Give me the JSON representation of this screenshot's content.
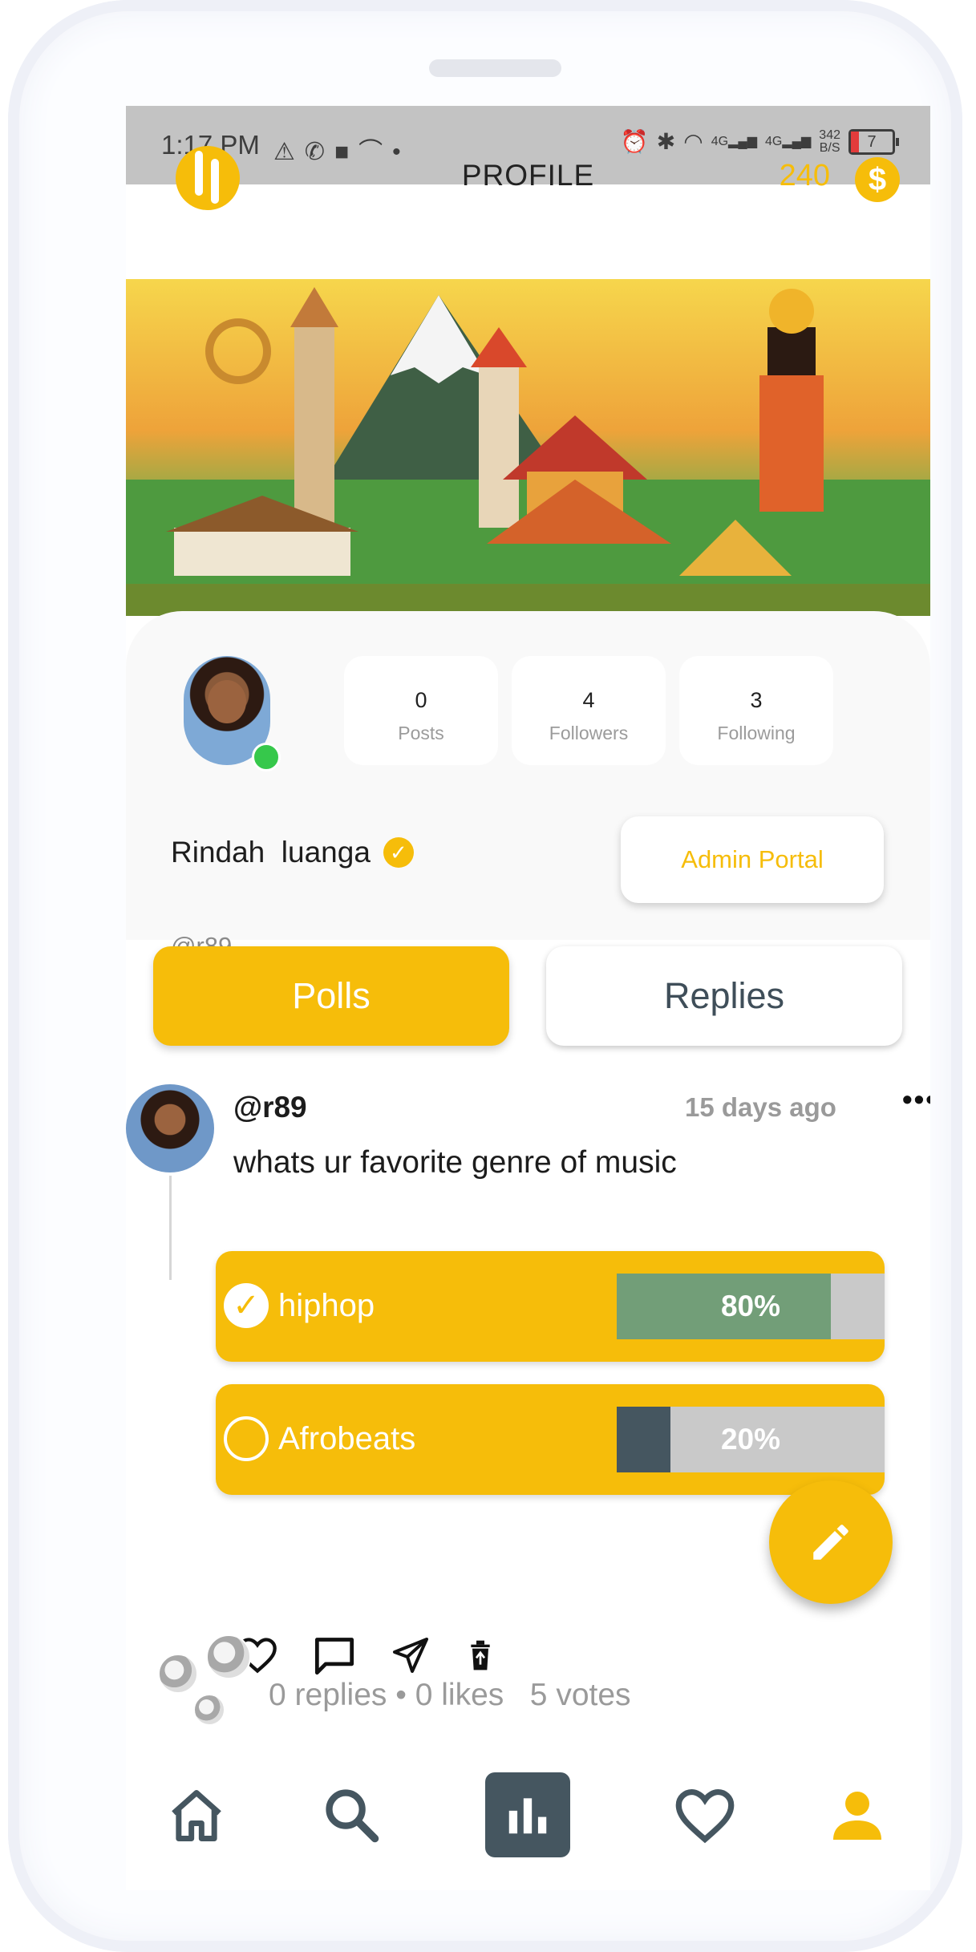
{
  "status_bar": {
    "time": "1:17 PM",
    "net_speed_value": "342",
    "net_speed_unit": "B/S",
    "signal_1": "4G",
    "signal_2": "4G",
    "battery": "7"
  },
  "header": {
    "title": "PROFILE",
    "coins": "240",
    "coin_symbol": "$"
  },
  "profile": {
    "stats": [
      {
        "value": "0",
        "label": "Posts"
      },
      {
        "value": "4",
        "label": "Followers"
      },
      {
        "value": "3",
        "label": "Following"
      }
    ],
    "name": "Rindah  luanga",
    "handle": "@r89",
    "admin_button": "Admin Portal",
    "online": true
  },
  "tabs": [
    {
      "label": "Polls",
      "active": true
    },
    {
      "label": "Replies",
      "active": false
    }
  ],
  "post": {
    "handle": "@r89",
    "time": "15 days ago",
    "more": "•••",
    "text": "whats ur favorite genre of music",
    "options": [
      {
        "label": "hiphop",
        "percent_label": "80%",
        "percent": 80,
        "selected": true,
        "fill_color": "#729e78"
      },
      {
        "label": "Afrobeats",
        "percent_label": "20%",
        "percent": 20,
        "selected": false,
        "fill_color": "#455660"
      }
    ],
    "stats": "0 replies • 0 likes   5 votes"
  },
  "colors": {
    "accent": "#f6bd0a",
    "dark": "#455660",
    "muted": "#9a9a9a"
  },
  "icons": {
    "actions": [
      "heart-icon",
      "comment-icon",
      "share-icon",
      "delete-icon"
    ],
    "fab": "pencil-icon",
    "nav": [
      "home-icon",
      "search-icon",
      "polls-icon",
      "heart-icon",
      "profile-icon"
    ]
  }
}
